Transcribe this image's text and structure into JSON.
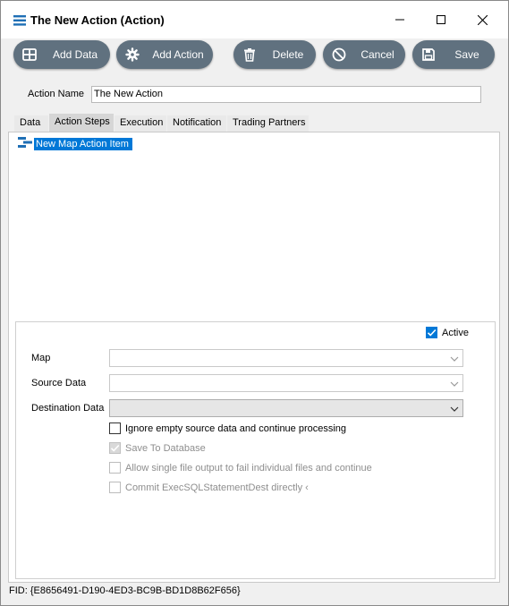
{
  "window": {
    "title": "The New Action (Action)",
    "app_icon": "list-icon",
    "controls": [
      "minimize-icon",
      "maximize-icon",
      "close-icon"
    ]
  },
  "toolbar": {
    "add_data": "Add Data",
    "add_action": "Add Action",
    "delete": "Delete",
    "cancel": "Cancel",
    "save": "Save",
    "button_color": "#60717f"
  },
  "action_name": {
    "label": "Action Name",
    "value": "The New Action"
  },
  "tabs": [
    {
      "label": "Data"
    },
    {
      "label": "Action Steps",
      "active": true
    },
    {
      "label": "Execution"
    },
    {
      "label": "Notification"
    },
    {
      "label": "Trading Partners"
    }
  ],
  "tree": {
    "items": [
      {
        "label": "New Map Action Item",
        "selected": true
      }
    ],
    "selection_color": "#0078d7"
  },
  "details": {
    "active_label": "Active",
    "active_checked": true,
    "map_label": "Map",
    "map_value": "",
    "source_label": "Source Data",
    "source_value": "",
    "destination_label": "Destination Data",
    "destination_value": "",
    "options": {
      "ignore_empty": "Ignore empty source data and continue processing",
      "save_to_db": "Save To Database",
      "allow_single": "Allow single file output to fail individual files and continue",
      "commit_sql": "Commit ExecSQLStatementDest directly ‹"
    }
  },
  "footer": {
    "fid": "FID: {E8656491-D190-4ED3-BC9B-BD1D8B62F656}"
  }
}
